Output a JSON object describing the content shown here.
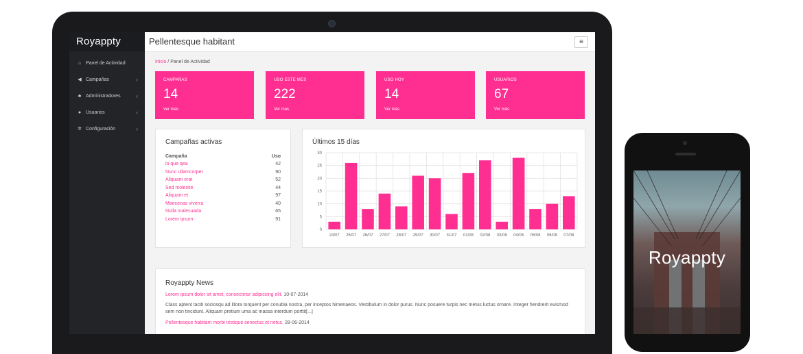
{
  "brand": "Royappty",
  "topbar": {
    "title": "Pellentesque habitant",
    "menu_icon": "hamburger-icon"
  },
  "sidebar": {
    "items": [
      {
        "label": "Panel de Actividad",
        "icon": "home-icon"
      },
      {
        "label": "Campañas",
        "icon": "megaphone-icon"
      },
      {
        "label": "Administradores",
        "icon": "sitemap-icon"
      },
      {
        "label": "Usuarios",
        "icon": "users-icon"
      },
      {
        "label": "Configuración",
        "icon": "gears-icon"
      }
    ]
  },
  "breadcrumb": {
    "home": "Inicio",
    "sep": " / ",
    "current": "Panel de Actividad"
  },
  "stats": [
    {
      "label": "CAMPAÑAS",
      "value": "14",
      "more": "Ver más"
    },
    {
      "label": "USO ESTE MES",
      "value": "222",
      "more": "Ver más"
    },
    {
      "label": "USO HOY",
      "value": "14",
      "more": "Ver más"
    },
    {
      "label": "USUARIOS",
      "value": "67",
      "more": "Ver más"
    }
  ],
  "active_campaigns": {
    "title": "Campañas activas",
    "col_name": "Campaña",
    "col_use": "Uso",
    "rows": [
      {
        "name": "lo que qea",
        "use": "42"
      },
      {
        "name": "Nunc ullamcorper",
        "use": "90"
      },
      {
        "name": "Aliquam erat",
        "use": "52"
      },
      {
        "name": "Sed molestie",
        "use": "44"
      },
      {
        "name": "Aliquam et",
        "use": "97"
      },
      {
        "name": "Maecenas viverra",
        "use": "40"
      },
      {
        "name": "Nulla malesuada",
        "use": "65"
      },
      {
        "name": "Lorem ipsum",
        "use": "91"
      }
    ]
  },
  "chart_data": {
    "type": "bar",
    "title": "Últimos 15 días",
    "categories": [
      "24/07",
      "25/07",
      "26/07",
      "27/07",
      "28/07",
      "29/07",
      "30/07",
      "31/07",
      "01/08",
      "02/08",
      "03/08",
      "04/08",
      "05/08",
      "06/08",
      "07/08"
    ],
    "values": [
      3,
      26,
      8,
      14,
      9,
      21,
      20,
      6,
      22,
      27,
      3,
      28,
      8,
      10,
      13
    ],
    "ylim": [
      0,
      30
    ],
    "yticks": [
      0,
      5,
      10,
      15,
      20,
      25,
      30
    ],
    "color": "#ff2f92",
    "grid": true
  },
  "news": {
    "title": "Royappty News",
    "items": [
      {
        "headline": "Lorem ipsum dolor sit amet, consectetur adipiscing elit.",
        "date": "10-07-2014",
        "body": "Class aptent taciti sociosqu ad litora torquent per conubia nostra, per inceptos himenaeos. Vestibulum in dolor purus. Nunc posuere turpis nec metus luctus ornare. Integer hendrerit euismod sem non tincidunt. Aliquam pretium uma ac massa interdum porttit[...]"
      },
      {
        "headline": "Pellentesque habitant morbi tristique senectus et netus.",
        "date": "28-06-2014",
        "body": ""
      }
    ]
  },
  "phone": {
    "brand": "Royappty"
  },
  "colors": {
    "accent": "#ff2f92",
    "sidebar": "#232427"
  }
}
